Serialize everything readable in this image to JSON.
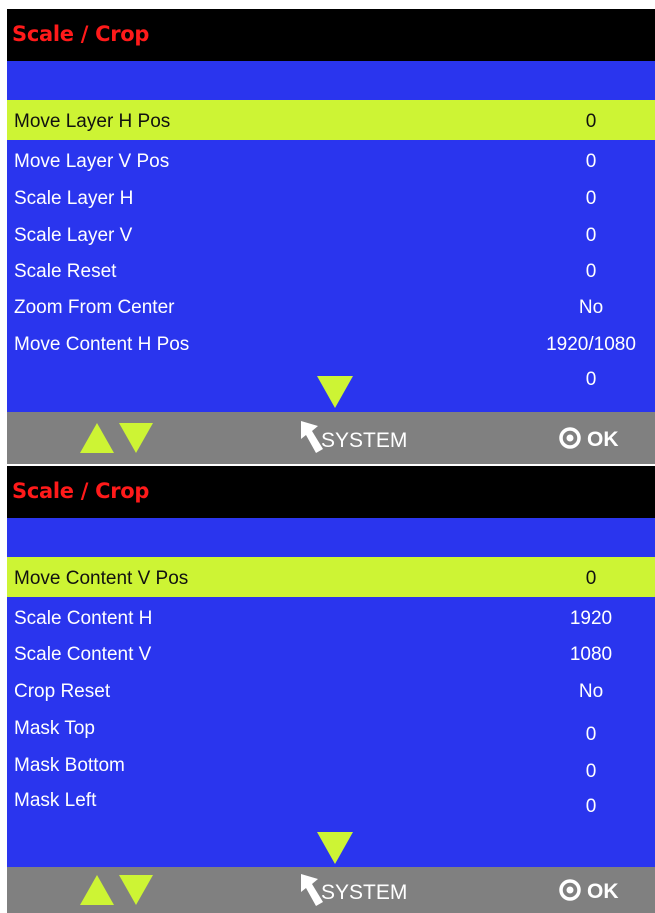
{
  "colors": {
    "background": "#2a35ee",
    "title_bar": "#000000",
    "title_text": "#ff1a1a",
    "highlight": "#cdf434",
    "bottom_bar": "#808080"
  },
  "screens": [
    {
      "title": "Scale / Crop",
      "selected_index": 0,
      "rows": [
        {
          "label": "Move Layer H Pos",
          "value": "0"
        },
        {
          "label": "Move Layer V Pos",
          "value": "0"
        },
        {
          "label": "Scale Layer H",
          "value": "0"
        },
        {
          "label": "Scale Layer V",
          "value": "0"
        },
        {
          "label": "Scale Reset",
          "value": "0"
        },
        {
          "label": "Zoom From Center",
          "value": "No"
        },
        {
          "label": "Move Content H Pos",
          "value": "1920/1080"
        },
        {
          "label": "",
          "value": "0"
        }
      ],
      "footer": {
        "nav_icons": [
          "up-arrow-icon",
          "down-arrow-icon"
        ],
        "back_icon": "back-arrow-icon",
        "back_label": "SYSTEM",
        "ok_icon": "ok-circle-icon",
        "ok_label": "OK"
      }
    },
    {
      "title": "Scale / Crop",
      "selected_index": 0,
      "rows": [
        {
          "label": "Move Content V Pos",
          "value": "0"
        },
        {
          "label": "Scale Content H",
          "value": "1920"
        },
        {
          "label": "Scale Content V",
          "value": "1080"
        },
        {
          "label": "Crop Reset",
          "value": "No"
        },
        {
          "label": "Mask Top",
          "value": "0"
        },
        {
          "label": "Mask Bottom",
          "value": "0"
        },
        {
          "label": "Mask Left",
          "value": "0"
        }
      ],
      "footer": {
        "nav_icons": [
          "up-arrow-icon",
          "down-arrow-icon"
        ],
        "back_icon": "back-arrow-icon",
        "back_label": "SYSTEM",
        "ok_icon": "ok-circle-icon",
        "ok_label": "OK"
      }
    }
  ]
}
